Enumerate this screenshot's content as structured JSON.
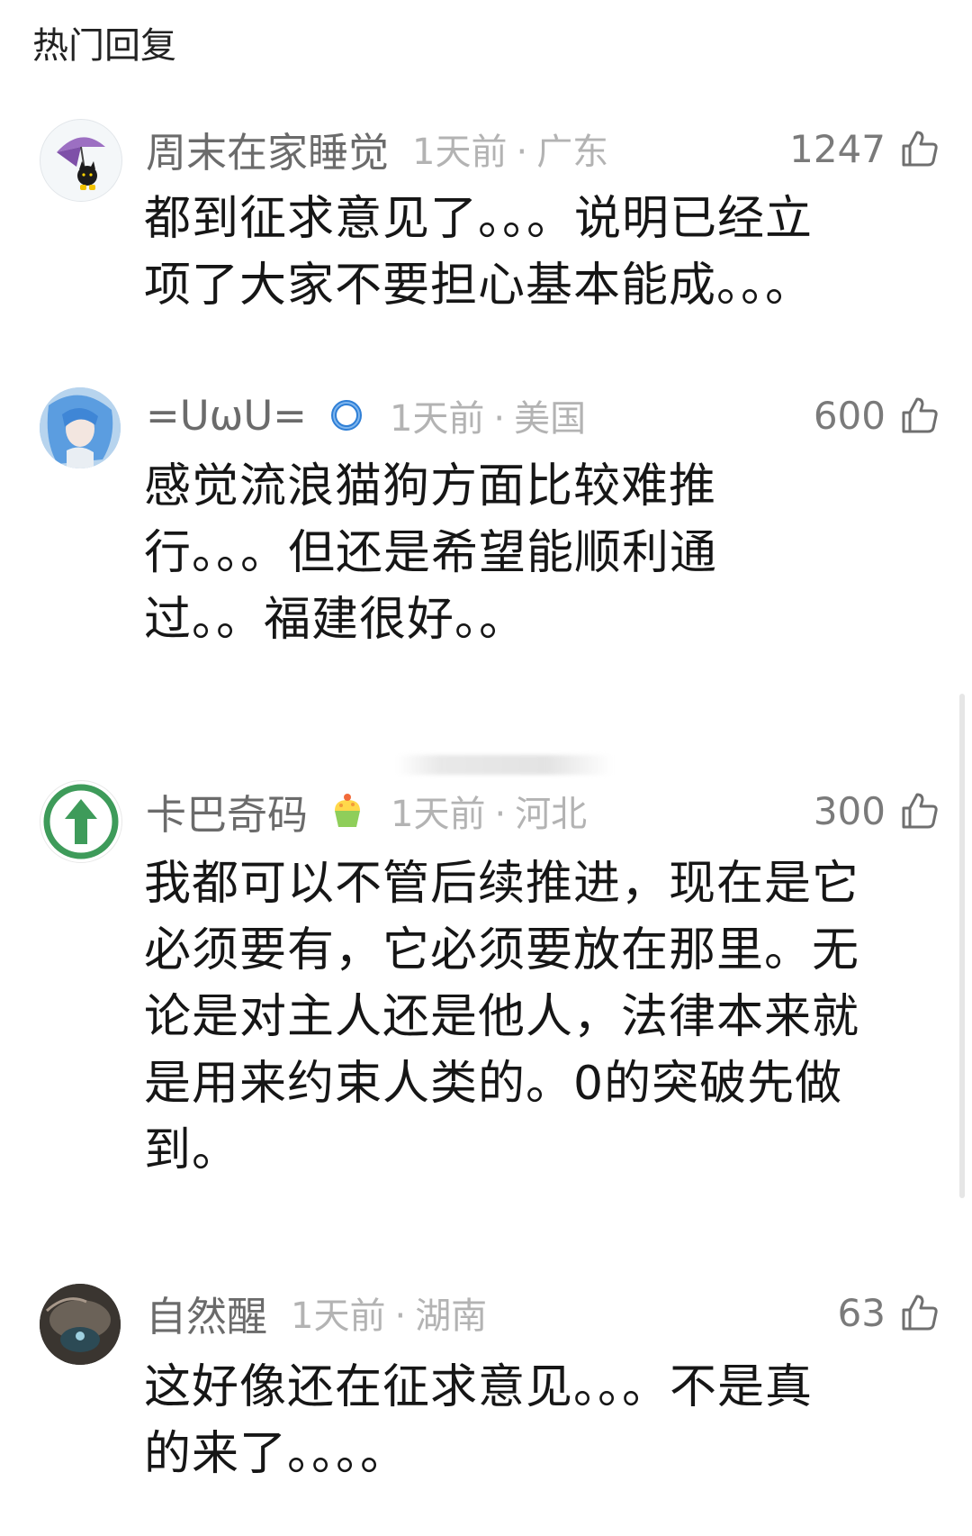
{
  "section_title": "热门回复",
  "comments": [
    {
      "username": "周末在家睡觉",
      "time": "1天前",
      "location": "广东",
      "likes": "1247",
      "text": "都到征求意见了。。。说明已经立项了大家不要担心基本能成。。。",
      "lines": [
        "都到征求意见了。。。说明已经立",
        "项了大家不要担心基本能成。。。"
      ]
    },
    {
      "username": "=ᑌωᑌ=",
      "time": "1天前",
      "location": "美国",
      "likes": "600",
      "lines": [
        "感觉流浪猫狗方面比较难推",
        "行。。。但还是希望能顺利通",
        "过。。福建很好。。"
      ]
    },
    {
      "username": "卡巴奇码",
      "time": "1天前",
      "location": "河北",
      "likes": "300",
      "lines": [
        "我都可以不管后续推进，现在是它",
        "必须要有，它必须要放在那里。无",
        "论是对主人还是他人，法律本来就",
        "是用来约束人类的。0的突破先做",
        "到。"
      ]
    },
    {
      "username": "自然醒",
      "time": "1天前",
      "location": "湖南",
      "likes": "63",
      "lines": [
        "这好像还在征求意见。。。不是真",
        "的来了。。。。"
      ]
    }
  ],
  "colors": {
    "username": "#6b6b6b",
    "meta": "#b3b3b3",
    "body": "#161616"
  }
}
